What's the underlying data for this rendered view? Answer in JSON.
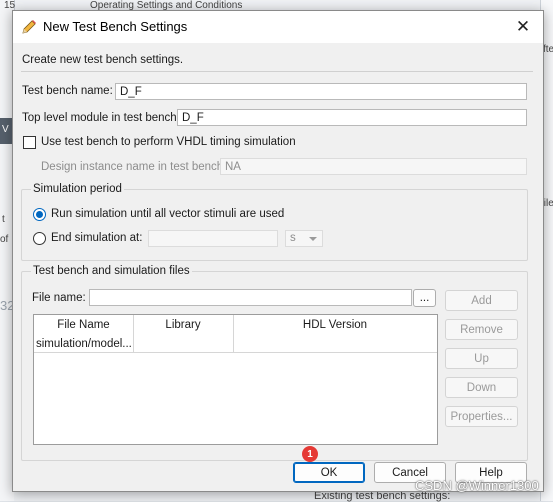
{
  "background": {
    "top_num": "15",
    "title_fragment": "Operating Settings and Conditions",
    "right_fragment_1": "fter",
    "right_fragment_2": "file",
    "left_fragment_1": "V",
    "left_fragment_2": "t",
    "left_fragment_3": "of",
    "left_num": "32",
    "bottom_fragment": "Existing test bench settings:"
  },
  "dialog": {
    "title": "New Test Bench Settings",
    "intro": "Create new test bench settings.",
    "test_bench_name_label": "Test bench name:",
    "test_bench_name_value": "D_F",
    "top_level_label": "Top level module in test bench:",
    "top_level_value": "D_F",
    "vhdl_timing_label": "Use test bench to perform VHDL timing simulation",
    "design_instance_label": "Design instance name in test bench:",
    "design_instance_value": "NA",
    "simulation_period": {
      "legend": "Simulation period",
      "option_run_all": "Run simulation until all vector stimuli are used",
      "option_end_at": "End simulation at:",
      "end_value": "",
      "unit": "s"
    },
    "files_group": {
      "legend": "Test bench and simulation files",
      "file_name_label": "File name:",
      "file_name_value": "",
      "browse_label": "...",
      "columns": [
        "File Name",
        "Library",
        "HDL Version"
      ],
      "rows": [
        {
          "file": "simulation/model...",
          "library": "",
          "hdl": ""
        }
      ],
      "buttons": {
        "add": "Add",
        "remove": "Remove",
        "up": "Up",
        "down": "Down",
        "properties": "Properties..."
      }
    },
    "footer": {
      "ok": "OK",
      "cancel": "Cancel",
      "help": "Help",
      "badge": "1"
    }
  },
  "watermark": "CSDN @Winner1300",
  "colors": {
    "accent": "#0067c0",
    "badge": "#e53935"
  },
  "icons": {
    "title": "pencil-icon",
    "close": "close-icon",
    "dropdown": "chevron-down-icon"
  }
}
